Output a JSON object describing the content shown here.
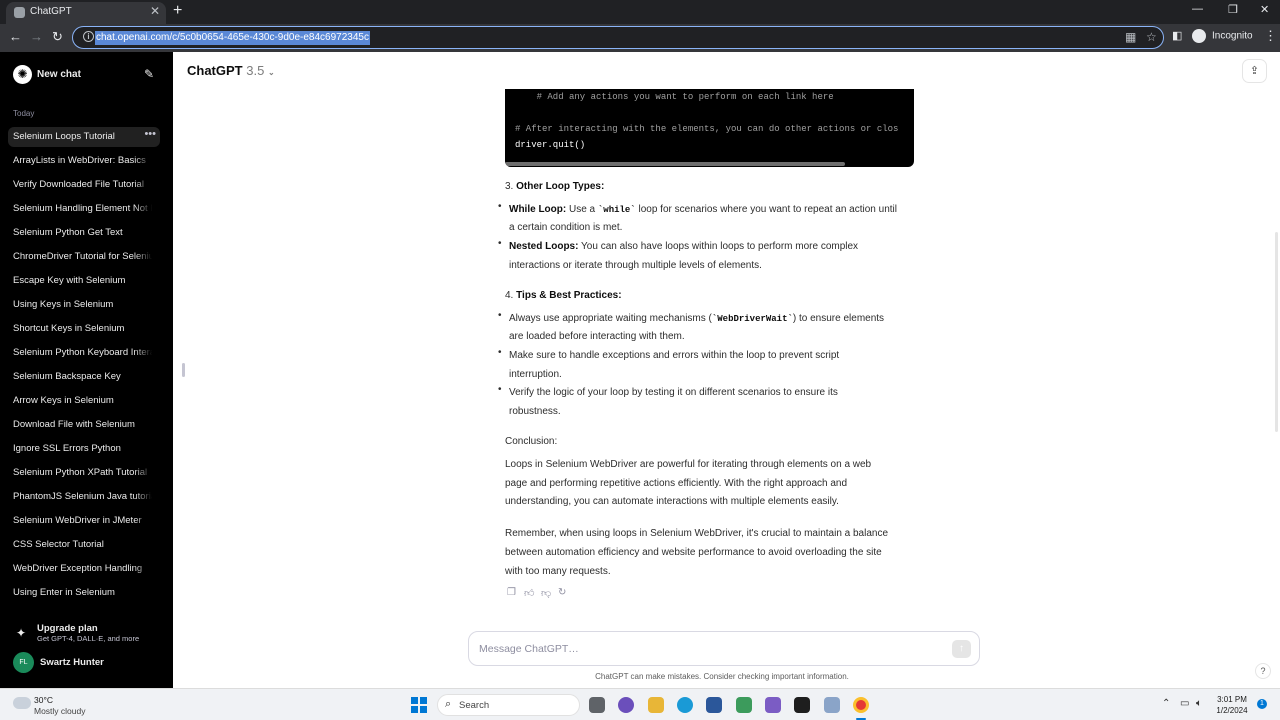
{
  "browser": {
    "tab_title": "ChatGPT",
    "tab_close": "✕",
    "new_tab": "+",
    "url": "chat.openai.com/c/5c0b0654-465e-430c-9d0e-e84c6972345c",
    "incognito_label": "Incognito",
    "window_min": "—",
    "window_max": "❐",
    "window_close": "✕"
  },
  "sidebar": {
    "new_chat_label": "New chat",
    "section_label": "Today",
    "history": [
      {
        "label": "Selenium Loops Tutorial",
        "active": true
      },
      {
        "label": "ArrayLists in WebDriver: Basics"
      },
      {
        "label": "Verify Downloaded File Tutorial"
      },
      {
        "label": "Selenium Handling Element Not F"
      },
      {
        "label": "Selenium Python Get Text"
      },
      {
        "label": "ChromeDriver Tutorial for Seleniu"
      },
      {
        "label": "Escape Key with Selenium"
      },
      {
        "label": "Using Keys in Selenium"
      },
      {
        "label": "Shortcut Keys in Selenium"
      },
      {
        "label": "Selenium Python Keyboard Intera"
      },
      {
        "label": "Selenium Backspace Key"
      },
      {
        "label": "Arrow Keys in Selenium"
      },
      {
        "label": "Download File with Selenium"
      },
      {
        "label": "Ignore SSL Errors Python"
      },
      {
        "label": "Selenium Python XPath Tutorial"
      },
      {
        "label": "PhantomJS Selenium Java tutoria"
      },
      {
        "label": "Selenium WebDriver in JMeter"
      },
      {
        "label": "CSS Selector Tutorial"
      },
      {
        "label": "WebDriver Exception Handling"
      },
      {
        "label": "Using Enter in Selenium"
      }
    ],
    "upgrade_title": "Upgrade plan",
    "upgrade_subtitle": "Get GPT-4, DALL·E, and more",
    "user_initials": "FL",
    "user_name": "Swartz Hunter"
  },
  "header": {
    "model_name": "ChatGPT",
    "model_version": "3.5"
  },
  "code_block": {
    "line1": "    # Add any actions you want to perform on each link here",
    "line2": "# After interacting with the elements, you can do other actions or clos",
    "line3": "driver.quit()"
  },
  "message": {
    "h3": "3. ",
    "h3_bold": "Other Loop Types:",
    "while_bold": "While Loop:",
    "while_a": " Use a ",
    "while_code": "`while`",
    "while_b": " loop for scenarios where you want to repeat an action until",
    "while_c": "a certain condition is met.",
    "nested_bold": "Nested Loops:",
    "nested_a": " You can also have loops within loops to perform more complex",
    "nested_b": "interactions or iterate through multiple levels of elements.",
    "h4": "4. ",
    "h4_bold": "Tips & Best Practices:",
    "tip1_a": "Always use appropriate waiting mechanisms (",
    "tip1_code": "`WebDriverWait`",
    "tip1_b": ") to ensure elements",
    "tip1_c": "are loaded before interacting with them.",
    "tip2_a": "Make sure to handle exceptions and errors within the loop to prevent script",
    "tip2_b": "interruption.",
    "tip3_a": "Verify the logic of your loop by testing it on different scenarios to ensure its",
    "tip3_b": "robustness.",
    "conclusion": "Conclusion:",
    "p1_a": "Loops in Selenium WebDriver are powerful for iterating through elements on a web",
    "p1_b": "page and performing repetitive actions efficiently. With the right approach and",
    "p1_c": "understanding, you can automate interactions with multiple elements easily.",
    "p2_a": "Remember, when using loops in Selenium WebDriver, it's crucial to maintain a balance",
    "p2_b": "between automation efficiency and website performance to avoid overloading the site",
    "p2_c": "with too many requests."
  },
  "composer": {
    "placeholder": "Message ChatGPT…",
    "disclaimer": "ChatGPT can make mistakes. Consider checking important information.",
    "help": "?"
  },
  "taskbar": {
    "weather_temp": "30°C",
    "weather_desc": "Mostly cloudy",
    "search_label": "Search",
    "time": "3:01 PM",
    "date": "1/2/2024",
    "notification_count": "1"
  },
  "colors": {
    "sidebar_bg": "#000000",
    "accent": "#0078d4"
  }
}
